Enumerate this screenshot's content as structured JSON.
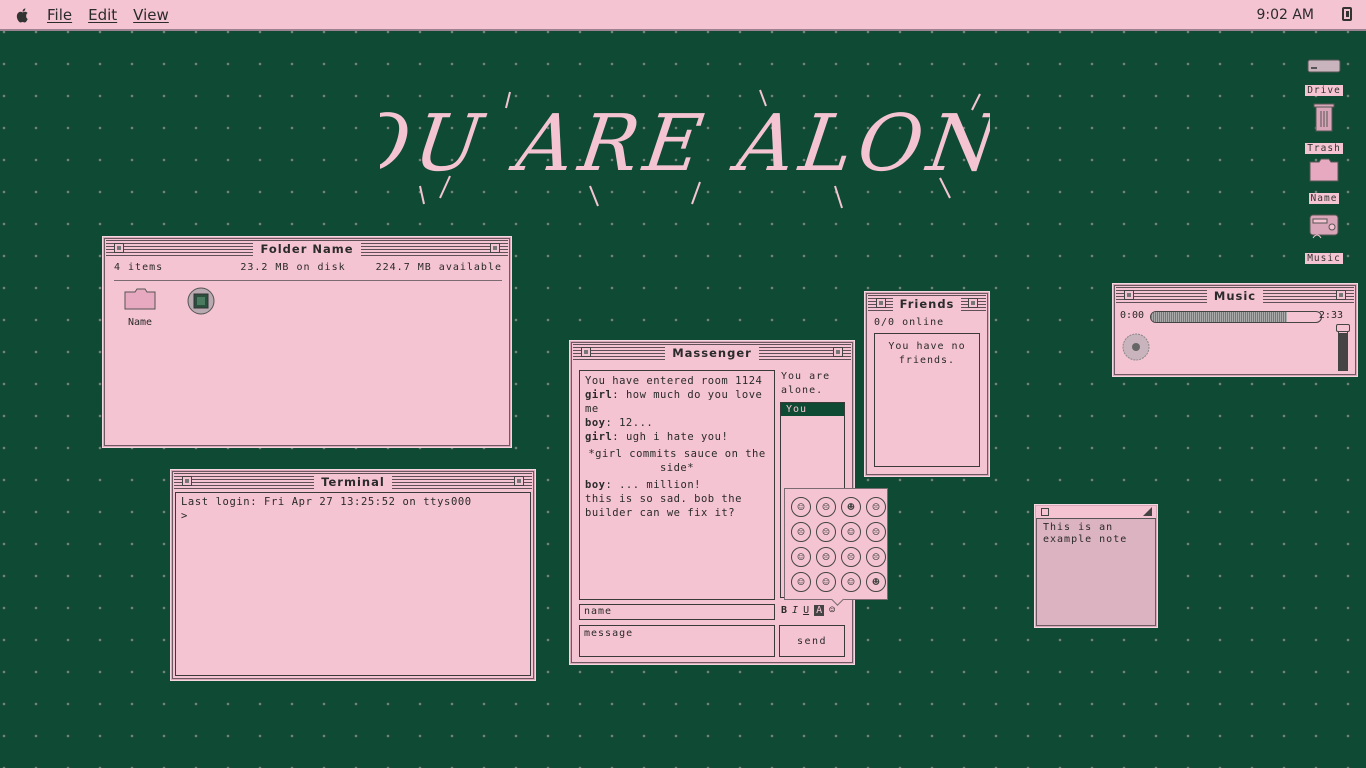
{
  "menubar": {
    "items": [
      "File",
      "Edit",
      "View"
    ],
    "clock": "9:02 AM"
  },
  "hero_text": "YOU ARE ALONE",
  "folder": {
    "title": "Folder Name",
    "item_count": "4 items",
    "disk_usage": "23.2 MB on disk",
    "available": "224.7 MB available",
    "icons": [
      {
        "label": "Name",
        "icon": "folder-icon"
      },
      {
        "label": "",
        "icon": "cd-icon"
      }
    ]
  },
  "terminal": {
    "title": "Terminal",
    "lines": [
      "Last login: Fri Apr 27 13:25:52 on ttys000",
      ">"
    ]
  },
  "messenger": {
    "title": "Massenger",
    "side_status": "You are alone.",
    "users": [
      "You"
    ],
    "chat": [
      {
        "speaker": "",
        "text": "You have entered room 1124"
      },
      {
        "speaker": "girl",
        "text": ": how much do you love me"
      },
      {
        "speaker": "boy",
        "text": ": 12..."
      },
      {
        "speaker": "girl",
        "text": ": ugh i hate you!"
      },
      {
        "speaker": "",
        "text": "*girl commits sauce on the side*"
      },
      {
        "speaker": "boy",
        "text": ": ... million!"
      },
      {
        "speaker": "",
        "text": "this is so sad. bob the builder can we fix it?"
      }
    ],
    "name_placeholder": "name",
    "message_placeholder": "message",
    "send_label": "send",
    "format_buttons": [
      "B",
      "I",
      "U",
      "A"
    ],
    "emojis": [
      "☺",
      "☹",
      "☻",
      "☹",
      "☹",
      "☹",
      "☺",
      "☹",
      "☺",
      "☹",
      "☹",
      "☹",
      "☺",
      "☺",
      "☺",
      "☻"
    ]
  },
  "friends": {
    "title": "Friends",
    "online": "0/0 online",
    "empty": "You have no friends."
  },
  "music": {
    "title": "Music",
    "elapsed": "0:00",
    "duration": "2:33",
    "progress": 0.8,
    "volume": 0.85
  },
  "note": {
    "text": "This is an example note"
  },
  "desktop_icons": [
    "Drive",
    "Trash",
    "Name",
    "Music"
  ],
  "colors": {
    "background": "#0f4a34",
    "pink": "#f5c4d3"
  }
}
